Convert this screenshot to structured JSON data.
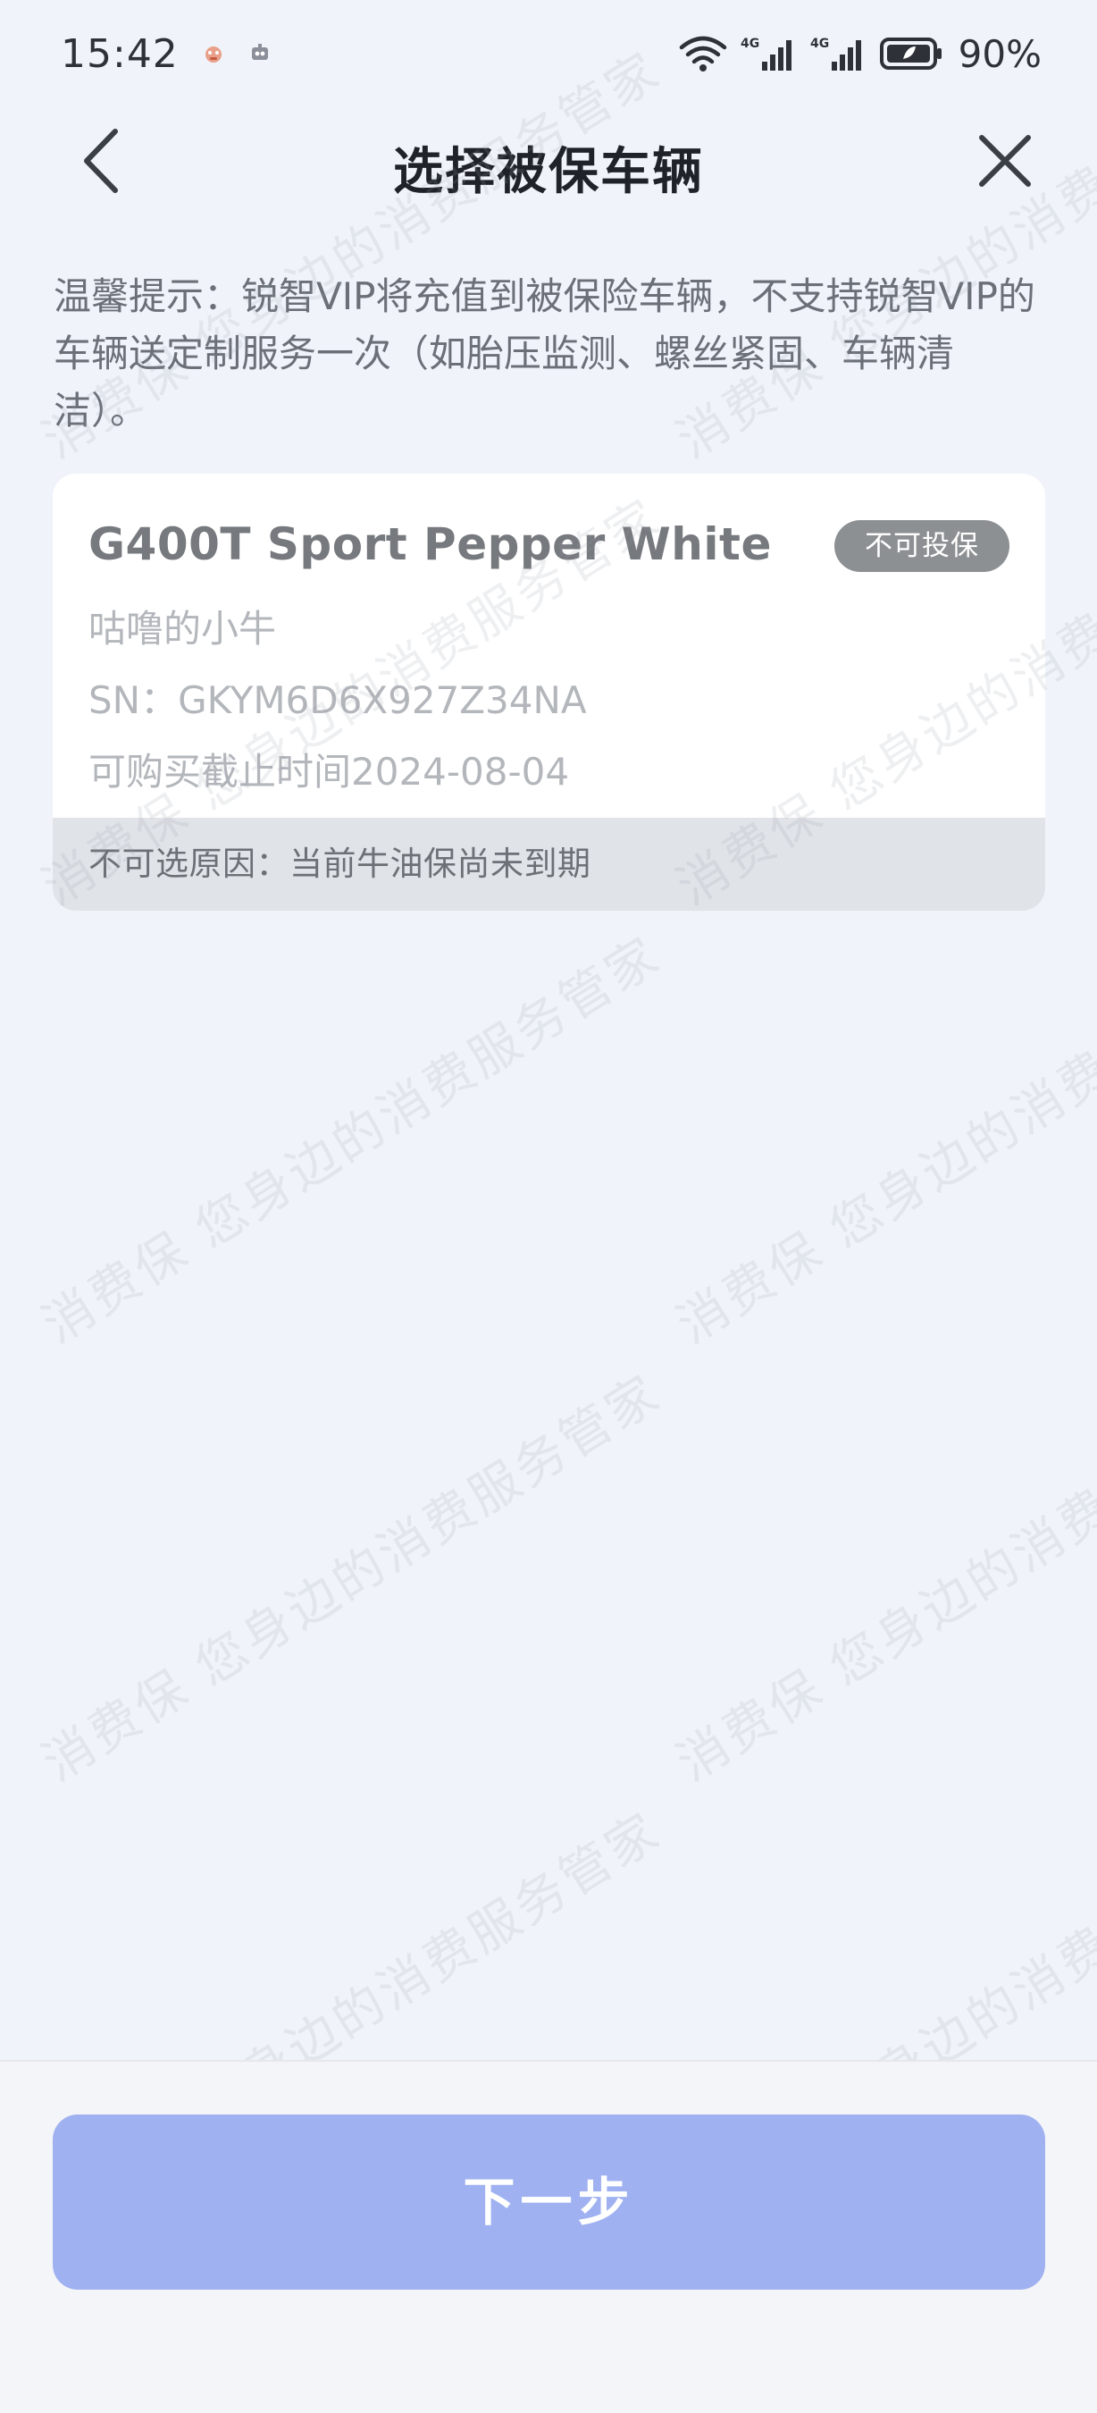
{
  "status_bar": {
    "time": "15:42",
    "battery_percent": "90%"
  },
  "header": {
    "title": "选择被保车辆"
  },
  "notice": {
    "text": "温馨提示：锐智VIP将充值到被保险车辆，不支持锐智VIP的车辆送定制服务一次（如胎压监测、螺丝紧固、车辆清洁）。"
  },
  "vehicle": {
    "name": "G400T Sport Pepper White",
    "badge": "不可投保",
    "owner": "咕噜的小牛",
    "serial": "SN：GKYM6D6X927Z34NA",
    "deadline": "可购买截止时间2024-08-04",
    "reason": "不可选原因：当前牛油保尚未到期"
  },
  "watermark": {
    "text": "消费保 您身边的消费服务管家"
  },
  "footer": {
    "next_label": "下一步"
  },
  "colors": {
    "background": "#f0f3f9",
    "badge": "#8d9093",
    "button": "#9fb1f0"
  },
  "icons": {
    "back": "chevron-left-icon",
    "close": "close-icon",
    "wifi": "wifi-icon",
    "signal": "signal-icon",
    "battery": "battery-icon"
  }
}
